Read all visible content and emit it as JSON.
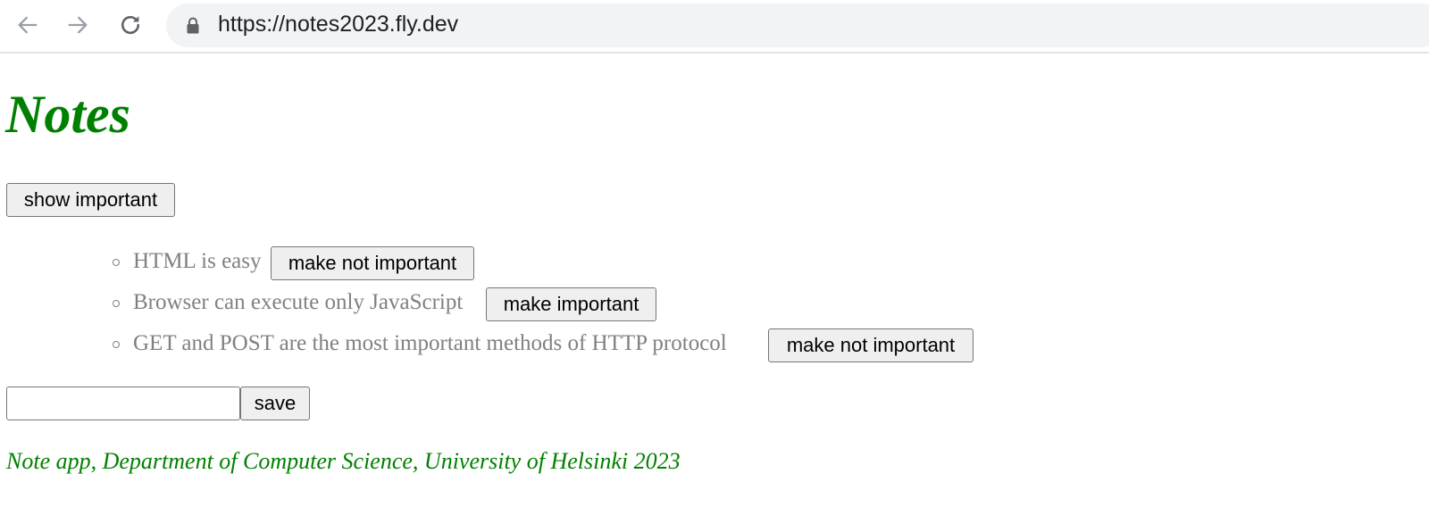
{
  "browser": {
    "url": "https://notes2023.fly.dev"
  },
  "page": {
    "title": "Notes",
    "show_button_label": "show important",
    "notes": [
      {
        "content": "HTML is easy",
        "button_label": "make not important"
      },
      {
        "content": "Browser can execute only JavaScript",
        "button_label": "make important"
      },
      {
        "content": "GET and POST are the most important methods of HTTP protocol",
        "button_label": "make not important"
      }
    ],
    "new_note_value": "",
    "save_label": "save",
    "footer": "Note app, Department of Computer Science, University of Helsinki 2023"
  },
  "colors": {
    "heading": "#008000",
    "note_text": "#808080",
    "button_bg": "#efefef",
    "button_border": "#767676",
    "address_bar_bg": "#f1f3f4"
  },
  "icons": {
    "back": "arrow-left-icon",
    "forward": "arrow-right-icon",
    "reload": "reload-icon",
    "lock": "lock-icon",
    "bullet": "circle-bullet"
  }
}
